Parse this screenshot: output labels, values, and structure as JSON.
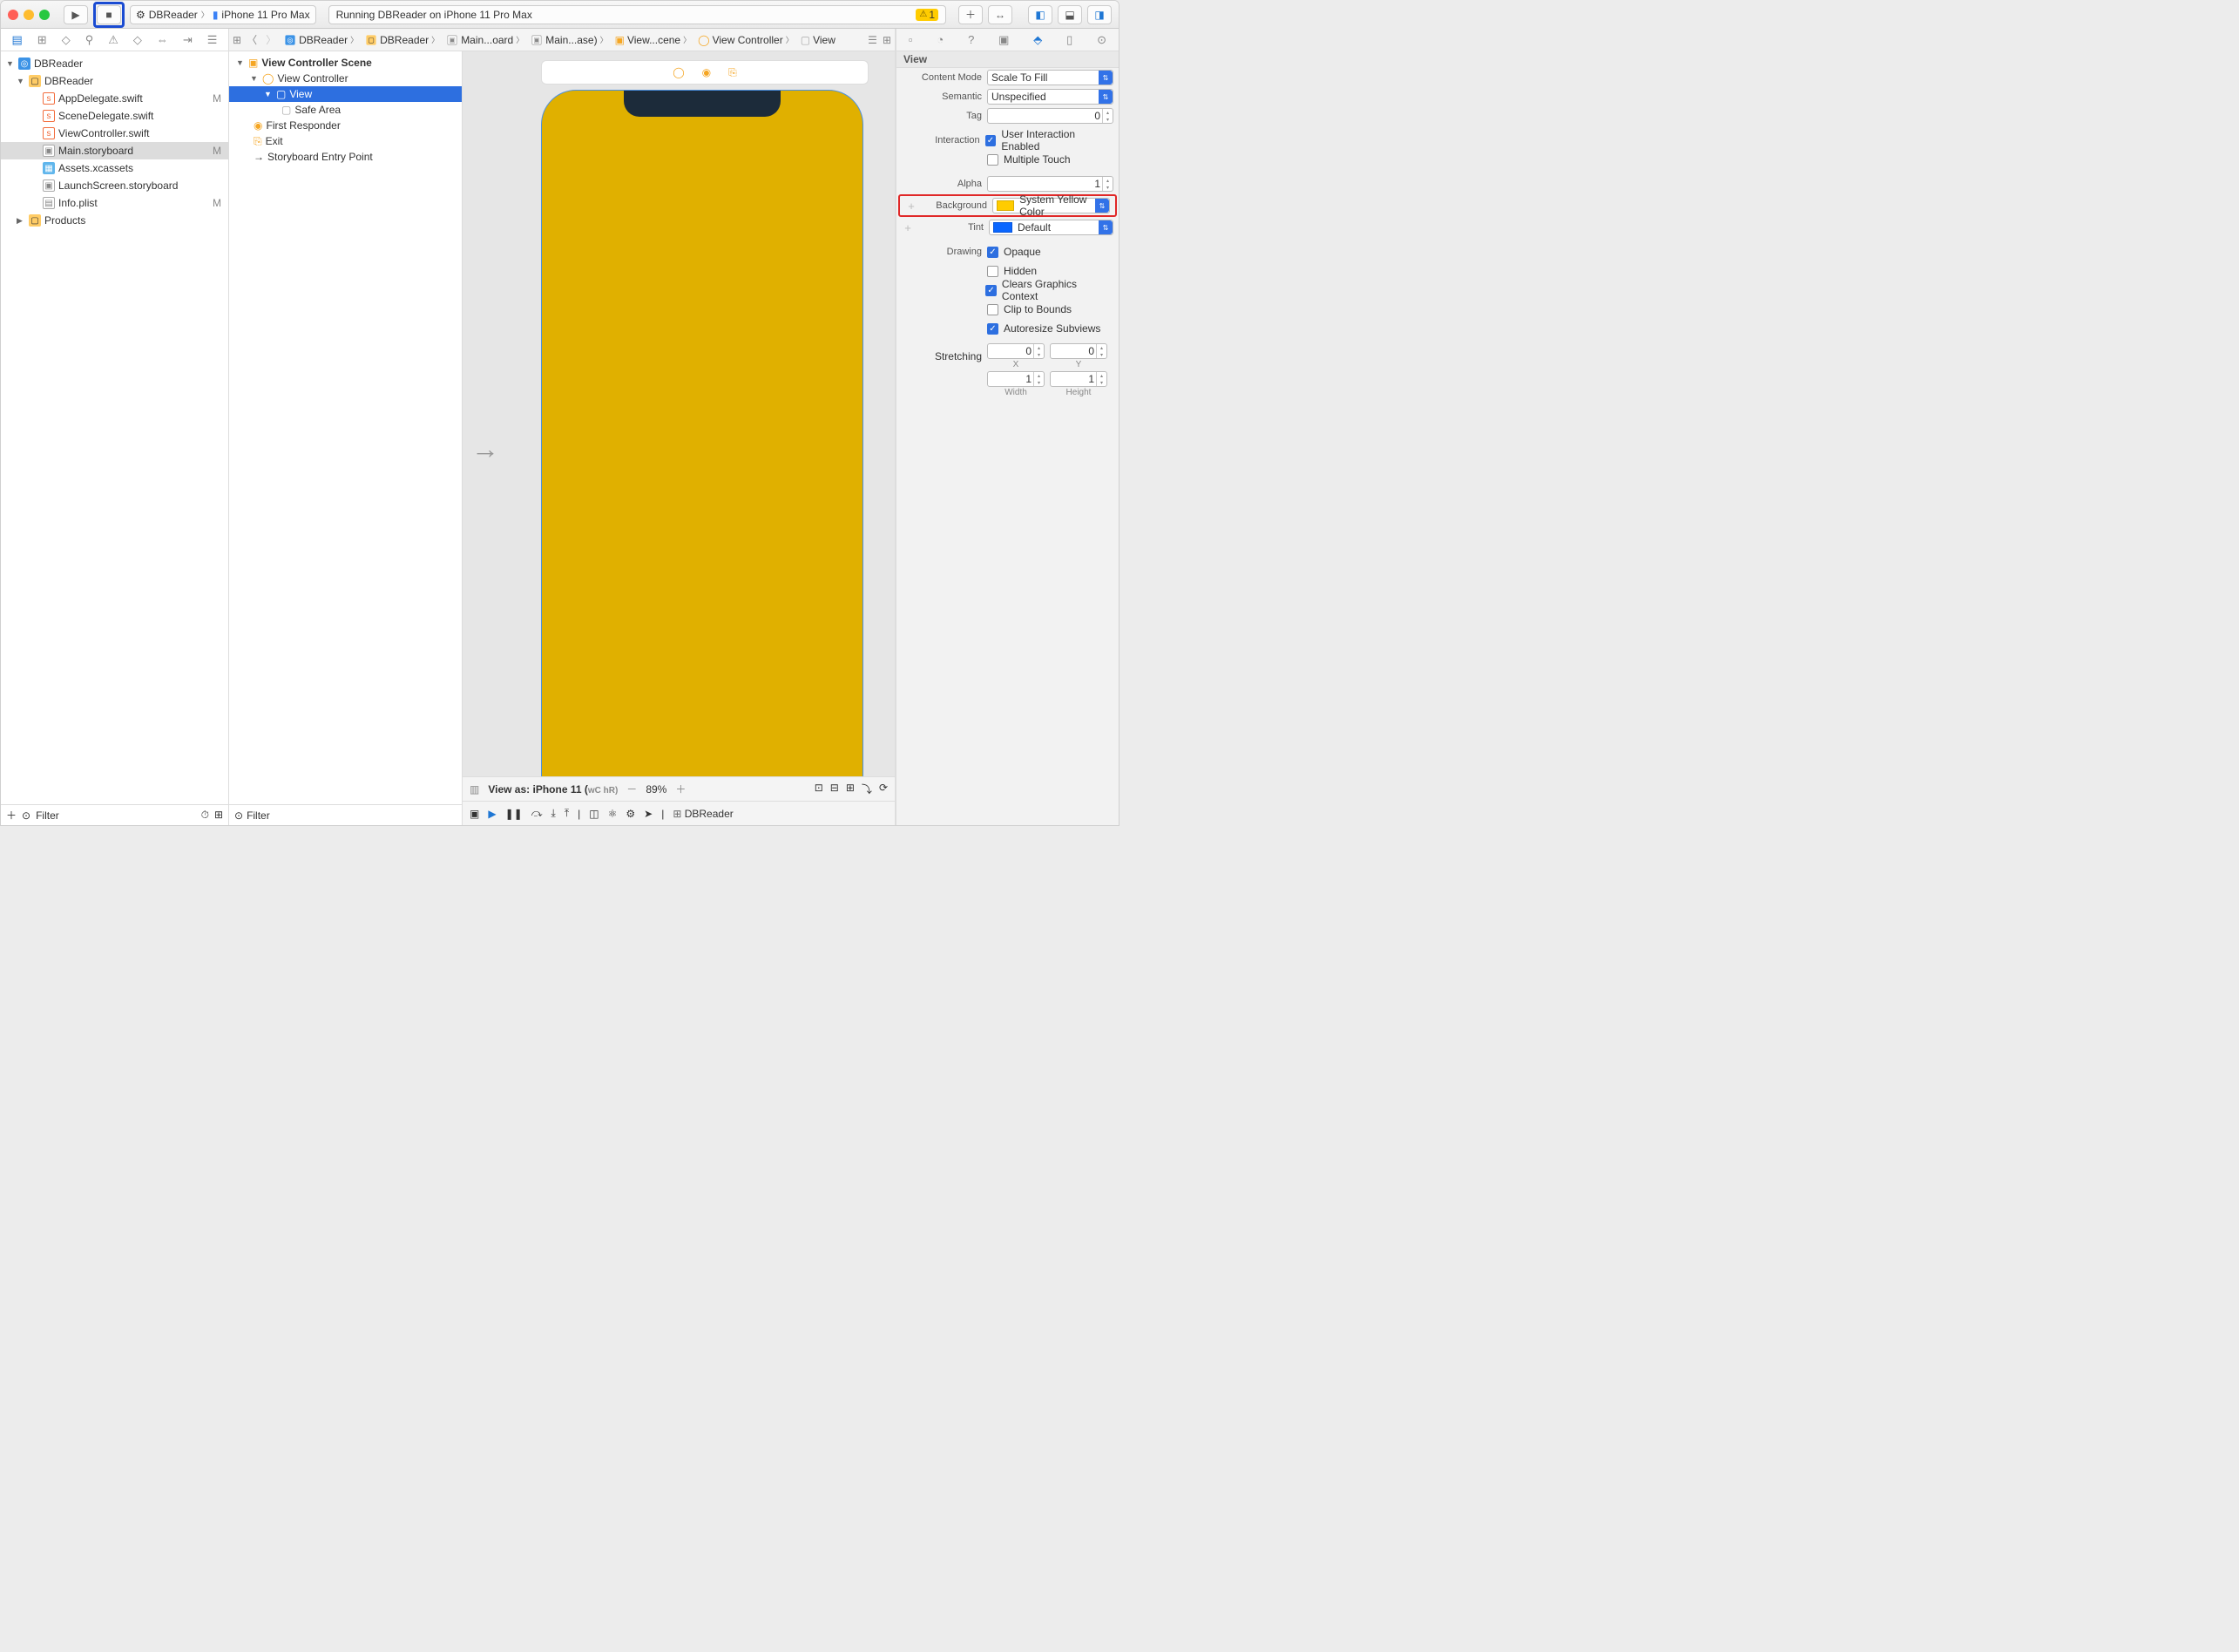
{
  "toolbar": {
    "scheme_app": "DBReader",
    "scheme_device": "iPhone 11 Pro Max",
    "status_text": "Running DBReader on iPhone 11 Pro Max",
    "warning_count": "1"
  },
  "navigator": {
    "root": "DBReader",
    "group": "DBReader",
    "files": [
      {
        "name": "AppDelegate.swift",
        "mod": "M",
        "icon": "swift"
      },
      {
        "name": "SceneDelegate.swift",
        "mod": "",
        "icon": "swift"
      },
      {
        "name": "ViewController.swift",
        "mod": "",
        "icon": "swift"
      },
      {
        "name": "Main.storyboard",
        "mod": "M",
        "icon": "story",
        "sel": true
      },
      {
        "name": "Assets.xcassets",
        "mod": "",
        "icon": "assets"
      },
      {
        "name": "LaunchScreen.storyboard",
        "mod": "",
        "icon": "story"
      },
      {
        "name": "Info.plist",
        "mod": "M",
        "icon": "plist"
      }
    ],
    "products": "Products",
    "filter_placeholder": "Filter"
  },
  "jump": {
    "items": [
      "DBReader",
      "DBReader",
      "Main...oard",
      "Main...ase)",
      "View...cene",
      "View Controller",
      "View"
    ]
  },
  "outline": {
    "root": "View Controller Scene",
    "vc": "View Controller",
    "view": "View",
    "safeArea": "Safe Area",
    "firstResponder": "First Responder",
    "exit": "Exit",
    "entryPoint": "Storyboard Entry Point",
    "filter_placeholder": "Filter"
  },
  "canvas": {
    "viewAs": "View as: iPhone 11 (",
    "wc": "wC",
    "hr": " hR)",
    "zoom": "89%"
  },
  "debug": {
    "target": "DBReader"
  },
  "inspector": {
    "title": "View",
    "labels": {
      "contentMode": "Content Mode",
      "semantic": "Semantic",
      "tag": "Tag",
      "interaction": "Interaction",
      "alpha": "Alpha",
      "background": "Background",
      "tint": "Tint",
      "drawing": "Drawing",
      "stretching": "Stretching",
      "x": "X",
      "y": "Y",
      "width": "Width",
      "height": "Height"
    },
    "values": {
      "contentMode": "Scale To Fill",
      "semantic": "Unspecified",
      "tag": "0",
      "userInteraction": "User Interaction Enabled",
      "multipleTouch": "Multiple Touch",
      "alpha": "1",
      "background": "System Yellow Color",
      "backgroundSwatch": "#ffcc00",
      "tint": "Default",
      "tintSwatch": "#0a66ff",
      "opaque": "Opaque",
      "hidden": "Hidden",
      "clearsContext": "Clears Graphics Context",
      "clipBounds": "Clip to Bounds",
      "autoresize": "Autoresize Subviews",
      "sx": "0",
      "sy": "0",
      "sw": "1",
      "sh": "1"
    }
  }
}
